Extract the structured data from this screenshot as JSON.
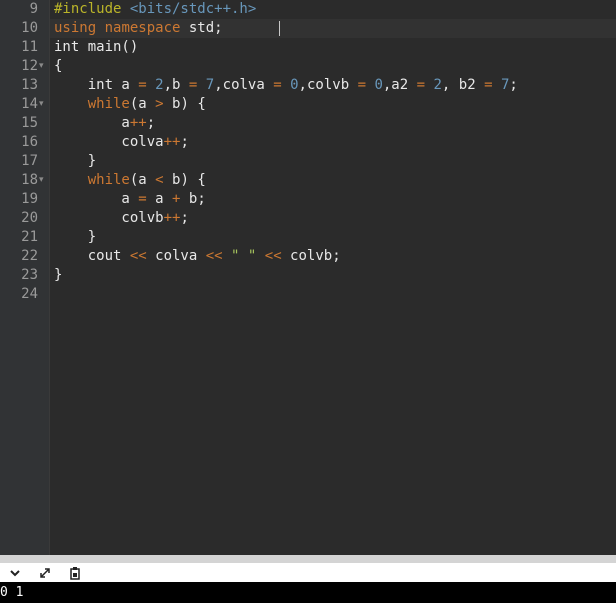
{
  "editor": {
    "lines": [
      {
        "number": "9",
        "fold": false,
        "tokens": [
          {
            "t": "#include ",
            "c": "pp"
          },
          {
            "t": "<bits/stdc++.h>",
            "c": "num"
          }
        ]
      },
      {
        "number": "10",
        "fold": false,
        "active": true,
        "tokens": [
          {
            "t": "using",
            "c": "kw"
          },
          {
            "t": " "
          },
          {
            "t": "namespace",
            "c": "kw"
          },
          {
            "t": " std;"
          }
        ]
      },
      {
        "number": "11",
        "fold": false,
        "tokens": [
          {
            "t": "int main()"
          }
        ]
      },
      {
        "number": "12",
        "fold": true,
        "tokens": [
          {
            "t": "{"
          }
        ]
      },
      {
        "number": "13",
        "fold": false,
        "tokens": [
          {
            "t": "    int a "
          },
          {
            "t": "=",
            "c": "op"
          },
          {
            "t": " "
          },
          {
            "t": "2",
            "c": "num"
          },
          {
            "t": ",b "
          },
          {
            "t": "=",
            "c": "op"
          },
          {
            "t": " "
          },
          {
            "t": "7",
            "c": "num"
          },
          {
            "t": ",colva "
          },
          {
            "t": "=",
            "c": "op"
          },
          {
            "t": " "
          },
          {
            "t": "0",
            "c": "num"
          },
          {
            "t": ",colvb "
          },
          {
            "t": "=",
            "c": "op"
          },
          {
            "t": " "
          },
          {
            "t": "0",
            "c": "num"
          },
          {
            "t": ",a2 "
          },
          {
            "t": "=",
            "c": "op"
          },
          {
            "t": " "
          },
          {
            "t": "2",
            "c": "num"
          },
          {
            "t": ", b2 "
          },
          {
            "t": "=",
            "c": "op"
          },
          {
            "t": " "
          },
          {
            "t": "7",
            "c": "num"
          },
          {
            "t": ";"
          }
        ]
      },
      {
        "number": "14",
        "fold": true,
        "tokens": [
          {
            "t": "    "
          },
          {
            "t": "while",
            "c": "kw"
          },
          {
            "t": "(a "
          },
          {
            "t": ">",
            "c": "op"
          },
          {
            "t": " b) {"
          }
        ]
      },
      {
        "number": "15",
        "fold": false,
        "tokens": [
          {
            "t": "        a"
          },
          {
            "t": "++",
            "c": "op"
          },
          {
            "t": ";"
          }
        ]
      },
      {
        "number": "16",
        "fold": false,
        "tokens": [
          {
            "t": "        colva"
          },
          {
            "t": "++",
            "c": "op"
          },
          {
            "t": ";"
          }
        ]
      },
      {
        "number": "17",
        "fold": false,
        "tokens": [
          {
            "t": "    }"
          }
        ]
      },
      {
        "number": "18",
        "fold": true,
        "tokens": [
          {
            "t": "    "
          },
          {
            "t": "while",
            "c": "kw"
          },
          {
            "t": "(a "
          },
          {
            "t": "<",
            "c": "op"
          },
          {
            "t": " b) {"
          }
        ]
      },
      {
        "number": "19",
        "fold": false,
        "tokens": [
          {
            "t": "        a "
          },
          {
            "t": "=",
            "c": "op"
          },
          {
            "t": " a "
          },
          {
            "t": "+",
            "c": "op"
          },
          {
            "t": " b;"
          }
        ]
      },
      {
        "number": "20",
        "fold": false,
        "tokens": [
          {
            "t": "        colvb"
          },
          {
            "t": "++",
            "c": "op"
          },
          {
            "t": ";"
          }
        ]
      },
      {
        "number": "21",
        "fold": false,
        "tokens": [
          {
            "t": "    }"
          }
        ]
      },
      {
        "number": "22",
        "fold": false,
        "tokens": [
          {
            "t": "    cout "
          },
          {
            "t": "<<",
            "c": "op"
          },
          {
            "t": " colva "
          },
          {
            "t": "<<",
            "c": "op"
          },
          {
            "t": " "
          },
          {
            "t": "\" \"",
            "c": "str"
          },
          {
            "t": " "
          },
          {
            "t": "<<",
            "c": "op"
          },
          {
            "t": " colvb;"
          }
        ]
      },
      {
        "number": "23",
        "fold": false,
        "tokens": [
          {
            "t": "}"
          }
        ]
      },
      {
        "number": "24",
        "fold": false,
        "tokens": []
      }
    ]
  },
  "toolbar": {
    "icons": [
      "collapse-chevron-icon",
      "expand-arrows-icon",
      "clipboard-icon"
    ]
  },
  "console": {
    "output": "0 1"
  }
}
